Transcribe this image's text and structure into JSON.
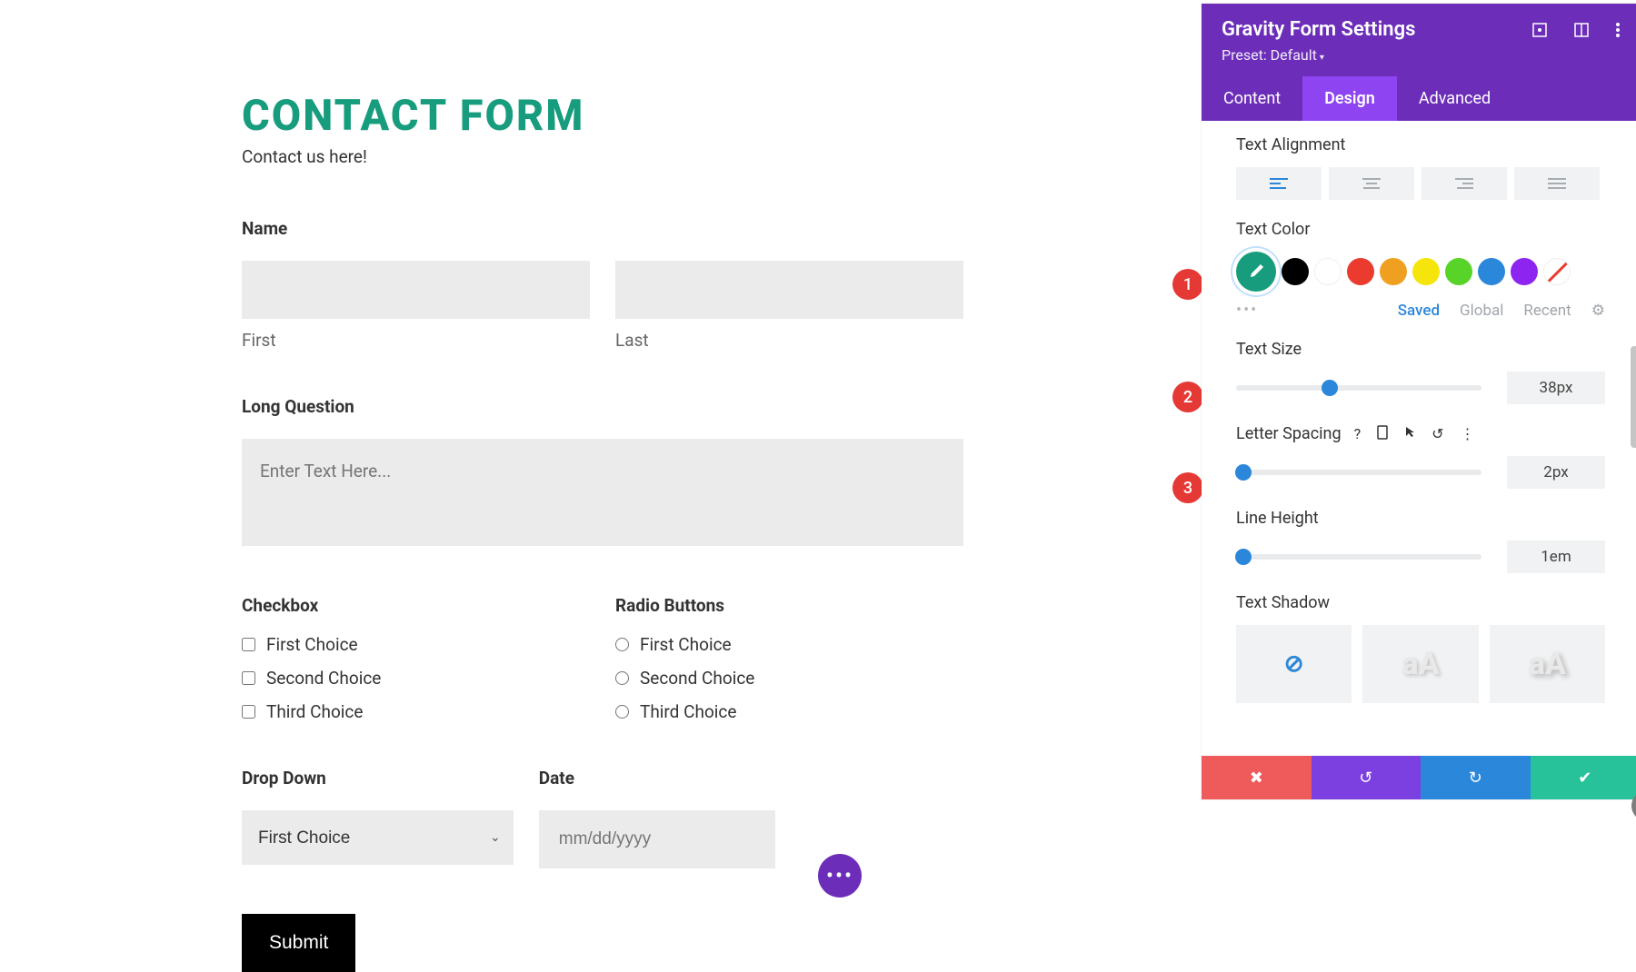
{
  "form": {
    "title": "CONTACT FORM",
    "subtitle": "Contact us here!",
    "name_label": "Name",
    "first_sub": "First",
    "last_sub": "Last",
    "long_q_label": "Long Question",
    "long_q_placeholder": "Enter Text Here...",
    "checkbox_label": "Checkbox",
    "radio_label": "Radio Buttons",
    "choices": [
      "First Choice",
      "Second Choice",
      "Third Choice"
    ],
    "dropdown_label": "Drop Down",
    "dropdown_value": "First Choice",
    "date_label": "Date",
    "date_placeholder": "mm/dd/yyyy",
    "submit_label": "Submit"
  },
  "callouts": {
    "c1": "1",
    "c2": "2",
    "c3": "3"
  },
  "panel": {
    "title": "Gravity Form Settings",
    "preset": "Preset: Default",
    "tabs": {
      "content": "Content",
      "design": "Design",
      "advanced": "Advanced"
    },
    "text_alignment_label": "Text Alignment",
    "text_color_label": "Text Color",
    "colors": {
      "selected": "#179c7d",
      "palette": [
        "#000000",
        "#ffffff",
        "#eb3b2e",
        "#f0a020",
        "#f5e50a",
        "#58d327",
        "#2b87da",
        "#8e24f0"
      ]
    },
    "swatch_tabs": {
      "saved": "Saved",
      "global": "Global",
      "recent": "Recent"
    },
    "text_size_label": "Text Size",
    "text_size_value": "38px",
    "letter_spacing_label": "Letter Spacing",
    "letter_spacing_value": "2px",
    "line_height_label": "Line Height",
    "line_height_value": "1em",
    "text_shadow_label": "Text Shadow",
    "shadow_aa": "aA"
  }
}
